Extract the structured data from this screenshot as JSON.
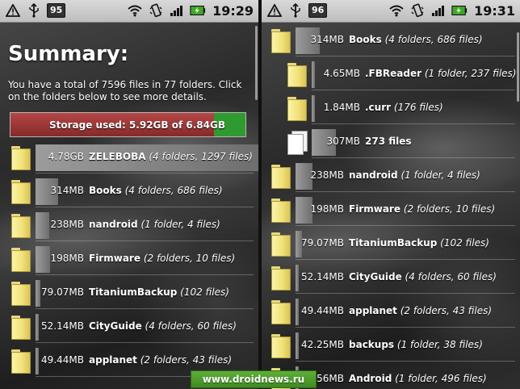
{
  "left_screen": {
    "status": {
      "notification_count": "95",
      "time": "19:29"
    },
    "summary_title": "Summary:",
    "summary_text": "You have a total of 7596 files in 77 folders. Click on the folders below to see more details.",
    "storage": {
      "label": "Storage used: 5.92GB of 6.84GB",
      "used_fraction": 0.865
    },
    "rows": [
      {
        "size": "4.78GB",
        "name": "ZELEBOBA",
        "details": "(4 folders, 1297 files)",
        "bar_fraction": 1.0
      },
      {
        "size": "314MB",
        "name": "Books",
        "details": "(4 folders, 686 files)",
        "bar_fraction": 0.1
      },
      {
        "size": "238MB",
        "name": "nandroid",
        "details": "(1 folder, 4 files)",
        "bar_fraction": 0.06
      },
      {
        "size": "198MB",
        "name": "Firmware",
        "details": "(2 folders, 10 files)",
        "bar_fraction": 0.065
      },
      {
        "size": "79.07MB",
        "name": "TitaniumBackup",
        "details": "(102 files)",
        "bar_fraction": 0.02
      },
      {
        "size": "52.14MB",
        "name": "CityGuide",
        "details": "(4 folders, 60 files)",
        "bar_fraction": 0.008
      },
      {
        "size": "49.44MB",
        "name": "applanet",
        "details": "(2 folders, 43 files)",
        "bar_fraction": 0.008
      }
    ]
  },
  "right_screen": {
    "status": {
      "notification_count": "96",
      "time": "19:31"
    },
    "rows": [
      {
        "size": "314MB",
        "name": "Books",
        "details": "(4 folders, 686 files)",
        "level": 0,
        "type": "folder",
        "bar_fraction": 1.0
      },
      {
        "size": "4.65MB",
        "name": ".FBReader",
        "details": "(1 folder, 237 files)",
        "level": 1,
        "type": "folder",
        "bar_fraction": 0.0
      },
      {
        "size": "1.84MB",
        "name": ".curr",
        "details": "(176 files)",
        "level": 1,
        "type": "folder",
        "bar_fraction": 0.0
      },
      {
        "size": "307MB",
        "name": "273 files",
        "details": "",
        "level": 1,
        "type": "file",
        "bar_fraction": 1.0
      },
      {
        "size": "238MB",
        "name": "nandroid",
        "details": "(1 folder, 4 files)",
        "level": 0,
        "type": "folder",
        "bar_fraction": 0.7
      },
      {
        "size": "198MB",
        "name": "Firmware",
        "details": "(2 folders, 10 files)",
        "level": 0,
        "type": "folder",
        "bar_fraction": 0.7
      },
      {
        "size": "79.07MB",
        "name": "TitaniumBackup",
        "details": "(102 files)",
        "level": 0,
        "type": "folder",
        "bar_fraction": 0.25
      },
      {
        "size": "52.14MB",
        "name": "CityGuide",
        "details": "(4 folders, 60 files)",
        "level": 0,
        "type": "folder",
        "bar_fraction": 0.0
      },
      {
        "size": "49.44MB",
        "name": "applanet",
        "details": "(2 folders, 43 files)",
        "level": 0,
        "type": "folder",
        "bar_fraction": 0.0
      },
      {
        "size": "42.25MB",
        "name": "backups",
        "details": "(1 folder, 38 files)",
        "level": 0,
        "type": "folder",
        "bar_fraction": 0.0
      },
      {
        "size": "37.56MB",
        "name": "Android",
        "details": "(1 folder, 496 files)",
        "level": 0,
        "type": "folder",
        "bar_fraction": 0.0
      }
    ]
  },
  "watermark": "www.droidnews.ru",
  "colors": {
    "storage_used": "#a63a3a",
    "storage_free": "#2f9a2f",
    "folder": "#f2e27a",
    "statusbar": "#cfcfcf"
  }
}
